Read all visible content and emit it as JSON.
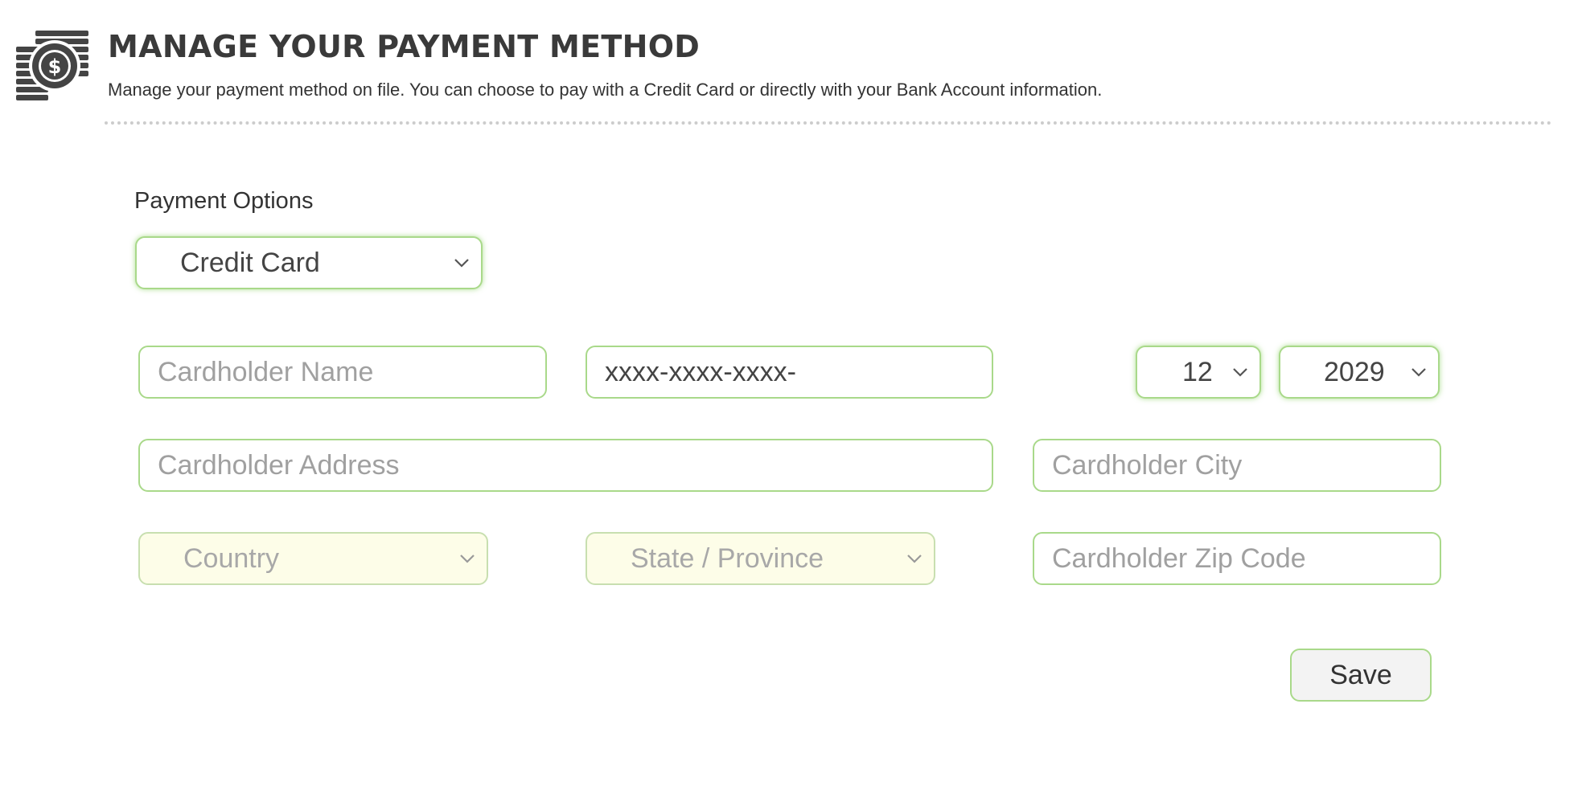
{
  "header": {
    "title": "MANAGE YOUR PAYMENT METHOD",
    "subtitle": "Manage your payment method on file. You can choose to pay with a Credit Card or directly with your Bank Account information.",
    "icon": "money-coins-icon"
  },
  "payment_options": {
    "label": "Payment Options",
    "selected": "Credit Card"
  },
  "card": {
    "name_placeholder": "Cardholder Name",
    "number_value": "xxxx-xxxx-xxxx-",
    "exp_month": "12",
    "exp_year": "2029",
    "address_placeholder": "Cardholder Address",
    "city_placeholder": "Cardholder City",
    "country_selected": "Country",
    "state_selected": "State / Province",
    "zip_placeholder": "Cardholder Zip Code"
  },
  "actions": {
    "save_label": "Save"
  },
  "colors": {
    "field_border": "#a9d98a",
    "disabled_bg": "#fdfde8",
    "title": "#3a3a3a"
  }
}
